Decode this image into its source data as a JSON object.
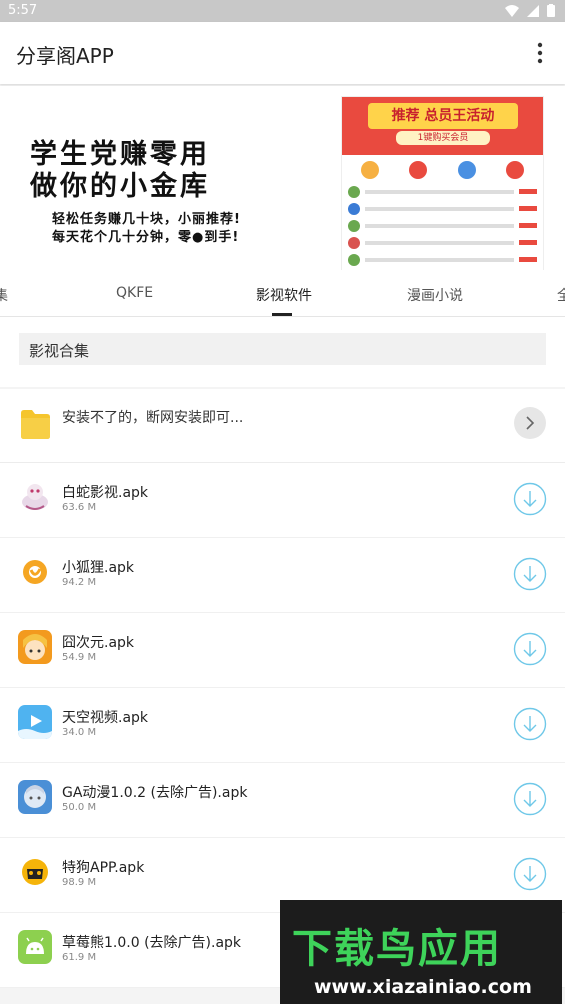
{
  "status_bar": {
    "time": "5:57"
  },
  "app_bar": {
    "title": "分享阁APP"
  },
  "banner": {
    "headline_1": "学生党赚零用",
    "headline_2": "做你的小金库",
    "sub_1": "轻松任务赚几十块，小丽推荐!",
    "sub_2": "每天花个几十分钟，零●到手!",
    "promo_title": "推荐 总员王活动",
    "promo_badge": "1键购买会员"
  },
  "tabs": [
    {
      "label": "集"
    },
    {
      "label": "QKFE"
    },
    {
      "label": "影视软件",
      "active": true
    },
    {
      "label": "漫画小说"
    },
    {
      "label": "全"
    }
  ],
  "category": {
    "label": "影视合集"
  },
  "notice": {
    "label": "安装不了的，断网安装即可..."
  },
  "files": [
    {
      "name": "白蛇影视.apk",
      "size": "63.6 M",
      "icon": "white-snake-app-icon"
    },
    {
      "name": "小狐狸.apk",
      "size": "94.2 M",
      "icon": "little-fox-app-icon"
    },
    {
      "name": "囧次元.apk",
      "size": "54.9 M",
      "icon": "jiong-ciyuan-app-icon"
    },
    {
      "name": "天空视频.apk",
      "size": "34.0 M",
      "icon": "sky-video-app-icon"
    },
    {
      "name": "GA动漫1.0.2 (去除广告).apk",
      "size": "50.0 M",
      "icon": "ga-anime-app-icon"
    },
    {
      "name": "特狗APP.apk",
      "size": "98.9 M",
      "icon": "tegou-app-icon"
    },
    {
      "name": "草莓熊1.0.0 (去除广告).apk",
      "size": "61.9 M",
      "icon": "strawberry-bear-app-icon"
    }
  ],
  "watermark": {
    "brand": "下载鸟应用",
    "url": "www.xiazainiao.com"
  },
  "colors": {
    "accent": "#6fc8e8",
    "folder": "#f5c52d",
    "brand_green": "#3ed35a"
  }
}
